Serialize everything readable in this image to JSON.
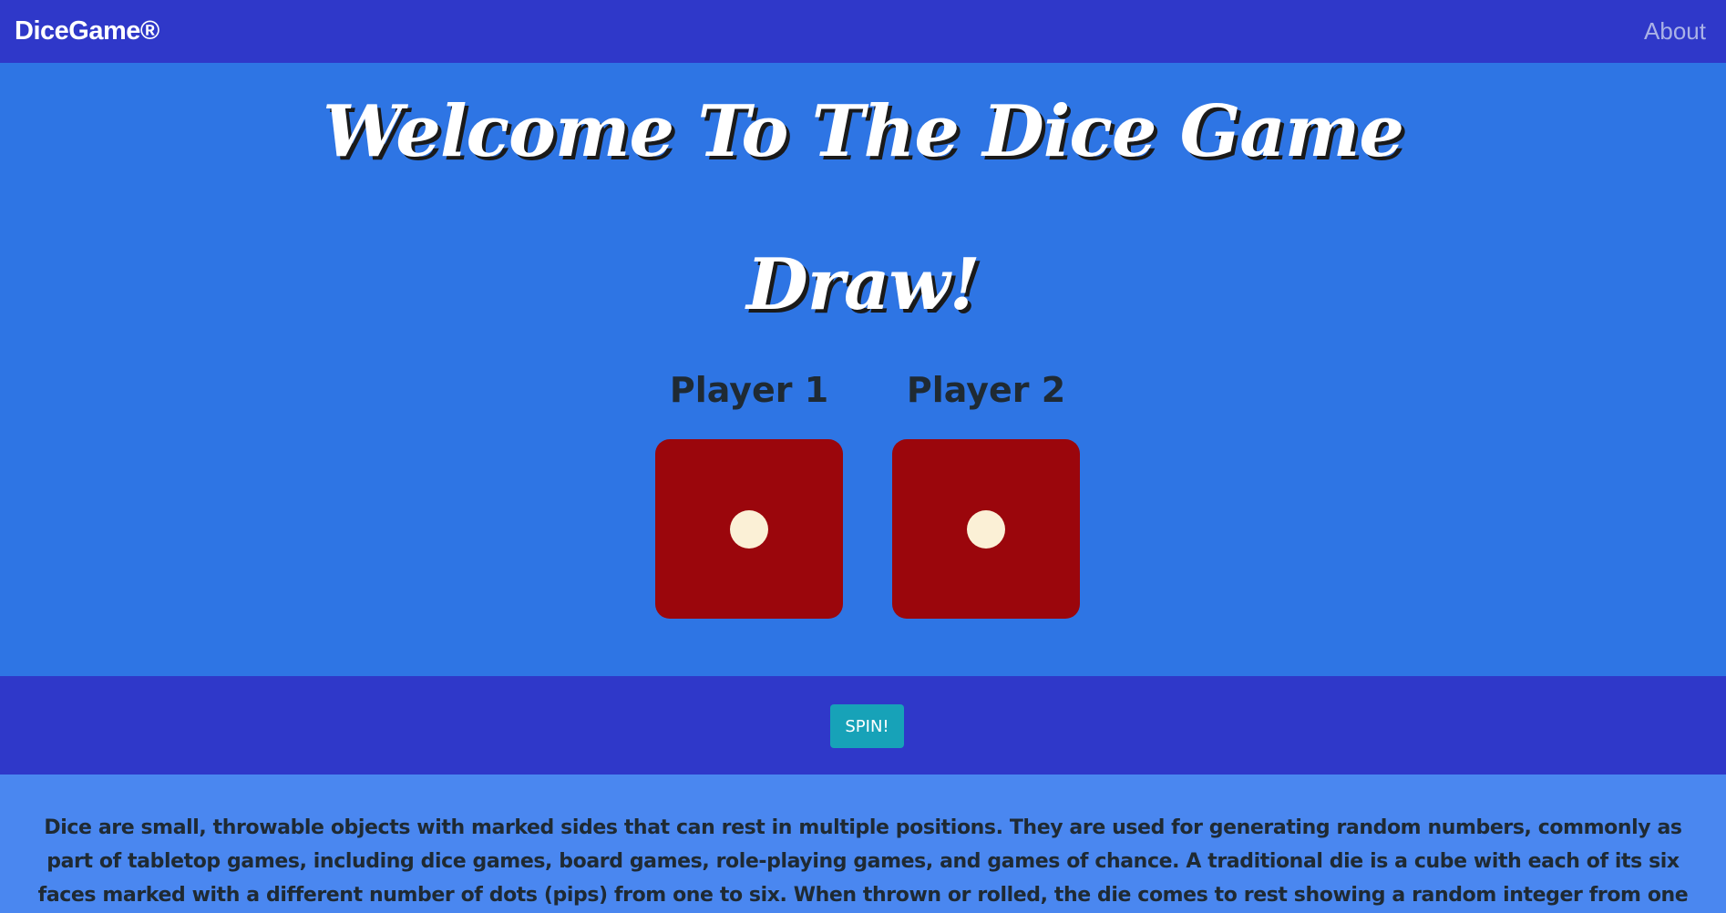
{
  "navbar": {
    "brand": "DiceGame®",
    "about_label": "About",
    "background": "#2f38c9"
  },
  "hero": {
    "title": "Welcome To The Dice Game",
    "result": "Draw!",
    "background": "#2e75e4"
  },
  "players": [
    {
      "label": "Player 1",
      "die_value": 1
    },
    {
      "label": "Player 2",
      "die_value": 1
    }
  ],
  "colors": {
    "die_face": "#9b060c",
    "pip": "#fbf0d6",
    "spin_button": "#17a2b8",
    "info_background": "#4a87f0"
  },
  "actions": {
    "spin_label": "SPIN!"
  },
  "info": {
    "text": "Dice are small, throwable objects with marked sides that can rest in multiple positions. They are used for generating random numbers, commonly as part of tabletop games, including dice games, board games, role-playing games, and games of chance. A traditional die is a cube with each of its six faces marked with a different number of dots (pips) from one to six. When thrown or rolled, the die comes to rest showing a random integer from one to six on its upper surface, with each value being equally"
  }
}
